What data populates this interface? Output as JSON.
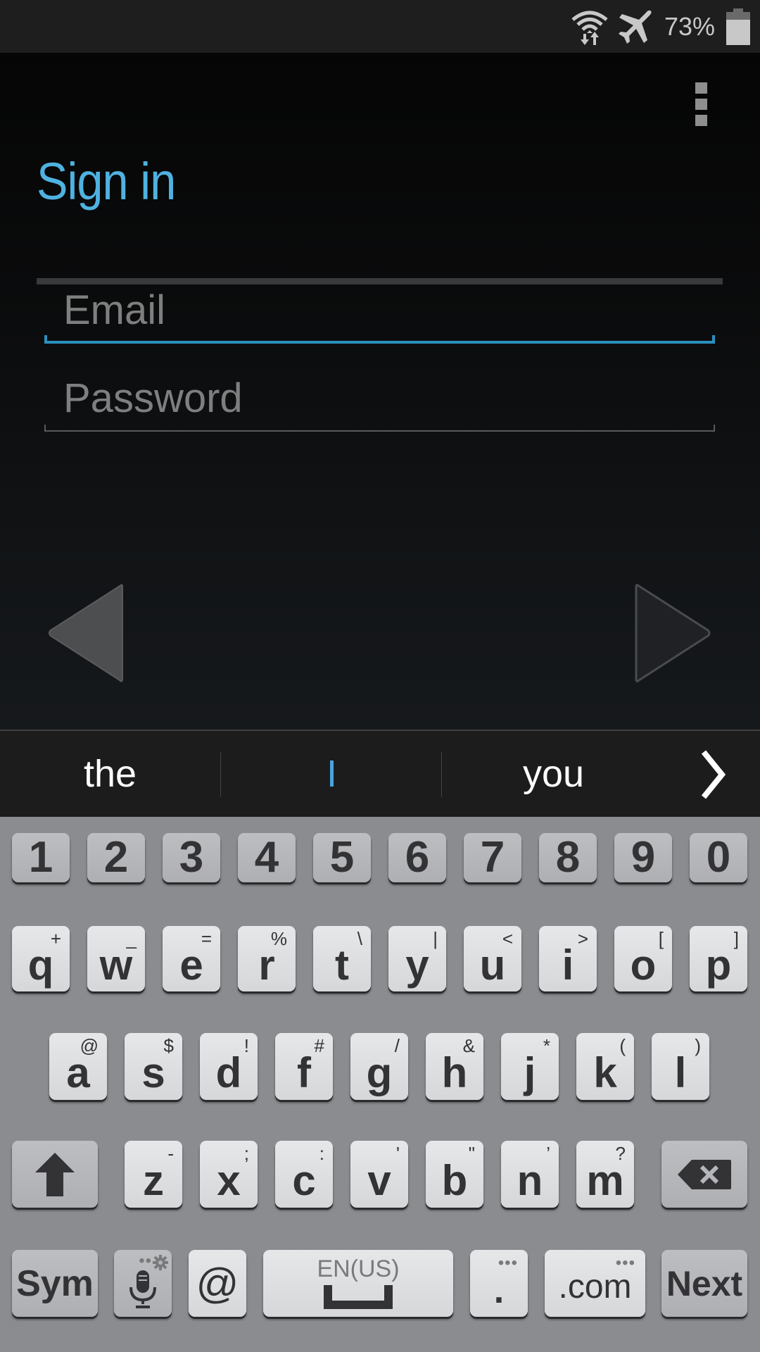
{
  "status_bar": {
    "icons": [
      "wifi-data-icon",
      "airplane-mode-icon",
      "battery-icon"
    ],
    "battery_percent": "73%",
    "battery_level": 0.73
  },
  "screen": {
    "title": "Sign in",
    "menu_icon": "overflow-menu-icon",
    "email": {
      "placeholder": "Email",
      "value": "",
      "focused": true
    },
    "password": {
      "placeholder": "Password",
      "value": ""
    },
    "back_icon": "back-arrow-icon",
    "next_icon": "next-arrow-icon"
  },
  "colors": {
    "accent": "#4fb2e0",
    "focus_line": "#2a8fbd",
    "keyboard_bg": "#8a8c90",
    "status_bar_bg": "#1e1e1e"
  },
  "suggestions": {
    "items": [
      "the",
      "I",
      "you"
    ],
    "more_icon": "chevron-right-icon"
  },
  "keyboard": {
    "number_row": [
      "1",
      "2",
      "3",
      "4",
      "5",
      "6",
      "7",
      "8",
      "9",
      "0"
    ],
    "row1": [
      {
        "k": "q",
        "alt": "+"
      },
      {
        "k": "w",
        "alt": "_"
      },
      {
        "k": "e",
        "alt": "="
      },
      {
        "k": "r",
        "alt": "%"
      },
      {
        "k": "t",
        "alt": "\\"
      },
      {
        "k": "y",
        "alt": "|"
      },
      {
        "k": "u",
        "alt": "<"
      },
      {
        "k": "i",
        "alt": ">"
      },
      {
        "k": "o",
        "alt": "["
      },
      {
        "k": "p",
        "alt": "]"
      }
    ],
    "row2": [
      {
        "k": "a",
        "alt": "@"
      },
      {
        "k": "s",
        "alt": "$"
      },
      {
        "k": "d",
        "alt": "!"
      },
      {
        "k": "f",
        "alt": "#"
      },
      {
        "k": "g",
        "alt": "/"
      },
      {
        "k": "h",
        "alt": "&"
      },
      {
        "k": "j",
        "alt": "*"
      },
      {
        "k": "k",
        "alt": "("
      },
      {
        "k": "l",
        "alt": ")"
      }
    ],
    "row3": [
      {
        "k": "z",
        "alt": "-"
      },
      {
        "k": "x",
        "alt": ";"
      },
      {
        "k": "c",
        "alt": ":"
      },
      {
        "k": "v",
        "alt": "'"
      },
      {
        "k": "b",
        "alt": "\""
      },
      {
        "k": "n",
        "alt": "’"
      },
      {
        "k": "m",
        "alt": "?"
      }
    ],
    "shift_icon": "shift-icon",
    "backspace_icon": "backspace-icon",
    "sym_label": "Sym",
    "mic_icon": "microphone-icon",
    "settings_icon": "gear-icon",
    "at_label": "@",
    "space_language": "EN(US)",
    "space_icon": "space-bar-icon",
    "period_label": ".",
    "dotcom_label": ".com",
    "more_dots": "•••",
    "next_label": "Next"
  }
}
